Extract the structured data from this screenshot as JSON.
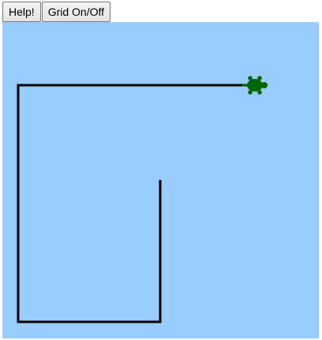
{
  "toolbar": {
    "help_label": "Help!",
    "grid_label": "Grid On/Off"
  },
  "canvas": {
    "background_color": "#99ccff",
    "path_color": "#000000",
    "turtle_color": "#006600",
    "turtle_icon": "turtle-icon",
    "grid_visible": false
  }
}
